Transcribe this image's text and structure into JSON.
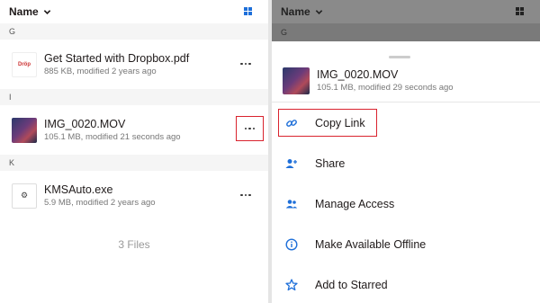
{
  "header": {
    "title": "Name"
  },
  "left": {
    "sections": [
      {
        "letter": "G",
        "file": {
          "name": "Get Started with Dropbox.pdf",
          "meta": "885 KB, modified 2 years ago",
          "thumb": "pdf",
          "thumb_text": "Dröp"
        }
      },
      {
        "letter": "I",
        "file": {
          "name": "IMG_0020.MOV",
          "meta": "105.1 MB, modified 21 seconds ago",
          "thumb": "video"
        }
      },
      {
        "letter": "K",
        "file": {
          "name": "KMSAuto.exe",
          "meta": "5.9 MB, modified 2 years ago",
          "thumb": "exe",
          "thumb_text": "⚙"
        }
      }
    ],
    "files_count": "3 Files"
  },
  "right": {
    "dim_section_letter": "G",
    "sheet_file": {
      "name": "IMG_0020.MOV",
      "meta": "105.1 MB, modified 29 seconds ago"
    },
    "actions": [
      {
        "label": "Copy Link",
        "icon": "link-icon"
      },
      {
        "label": "Share",
        "icon": "add-person-icon"
      },
      {
        "label": "Manage Access",
        "icon": "people-icon"
      },
      {
        "label": "Make Available Offline",
        "icon": "info-circle-icon"
      },
      {
        "label": "Add to Starred",
        "icon": "star-icon"
      }
    ]
  },
  "colors": {
    "accent": "#1e6fd9",
    "highlight": "#d9232e",
    "text": "#1e1919",
    "meta": "#777777"
  }
}
